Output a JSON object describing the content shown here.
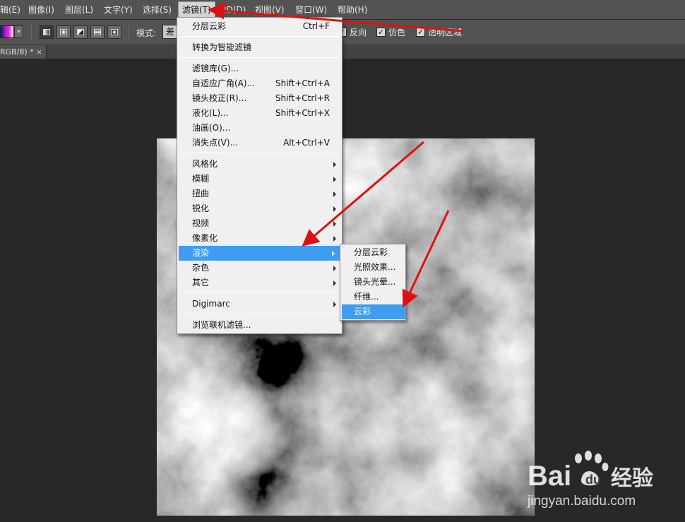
{
  "menubar": {
    "items": [
      {
        "label": "辑(E)"
      },
      {
        "label": "图像(I)"
      },
      {
        "label": "图层(L)"
      },
      {
        "label": "文字(Y)"
      },
      {
        "label": "选择(S)"
      },
      {
        "label": "滤镜(T)"
      },
      {
        "label": "3D(D)"
      },
      {
        "label": "视图(V)"
      },
      {
        "label": "窗口(W)"
      },
      {
        "label": "帮助(H)"
      }
    ]
  },
  "options_bar": {
    "mode_label": "模式:",
    "mode_value": "差",
    "reverse_label": "反向",
    "dither_label": "仿色",
    "transparency_label": "透明区域",
    "gradient_colors": [
      "#1a1060",
      "#7a2bd8",
      "#ff2bd0",
      "#ffffff"
    ]
  },
  "document_tab": {
    "title": "RGB/8) *",
    "close_glyph": "×"
  },
  "filter_menu": {
    "last_filter": {
      "label": "分层云彩",
      "shortcut": "Ctrl+F"
    },
    "smart_filters": {
      "label": "转换为智能滤镜"
    },
    "gallery": {
      "label": "滤镜库(G)..."
    },
    "adaptive_wide": {
      "label": "自适应广角(A)...",
      "shortcut": "Shift+Ctrl+A"
    },
    "lens_correction": {
      "label": "镜头校正(R)...",
      "shortcut": "Shift+Ctrl+R"
    },
    "liquify": {
      "label": "液化(L)...",
      "shortcut": "Shift+Ctrl+X"
    },
    "oil_paint": {
      "label": "油画(O)..."
    },
    "vanishing_point": {
      "label": "消失点(V)...",
      "shortcut": "Alt+Ctrl+V"
    },
    "stylize": {
      "label": "风格化"
    },
    "blur": {
      "label": "模糊"
    },
    "distort": {
      "label": "扭曲"
    },
    "sharpen": {
      "label": "锐化"
    },
    "video": {
      "label": "视频"
    },
    "pixelate": {
      "label": "像素化"
    },
    "render": {
      "label": "渲染"
    },
    "noise": {
      "label": "杂色"
    },
    "other": {
      "label": "其它"
    },
    "digimarc": {
      "label": "Digimarc"
    },
    "browse_online": {
      "label": "浏览联机滤镜..."
    }
  },
  "render_submenu": {
    "difference_clouds": "分层云彩",
    "lighting_effects": "光照效果...",
    "lens_flare": "镜头光晕...",
    "fibers": "纤维...",
    "clouds": "云彩"
  },
  "colors": {
    "highlight": "#3f9cf0",
    "annotation_arrow": "#e01010",
    "menu_bg": "#f0f0f0",
    "app_bg": "#282828",
    "toolbar_bg": "#535353"
  },
  "watermark": {
    "logo_text_1": "Bai",
    "logo_text_2": "du",
    "logo_cn": "经验",
    "url": "jingyan.baidu.com"
  }
}
